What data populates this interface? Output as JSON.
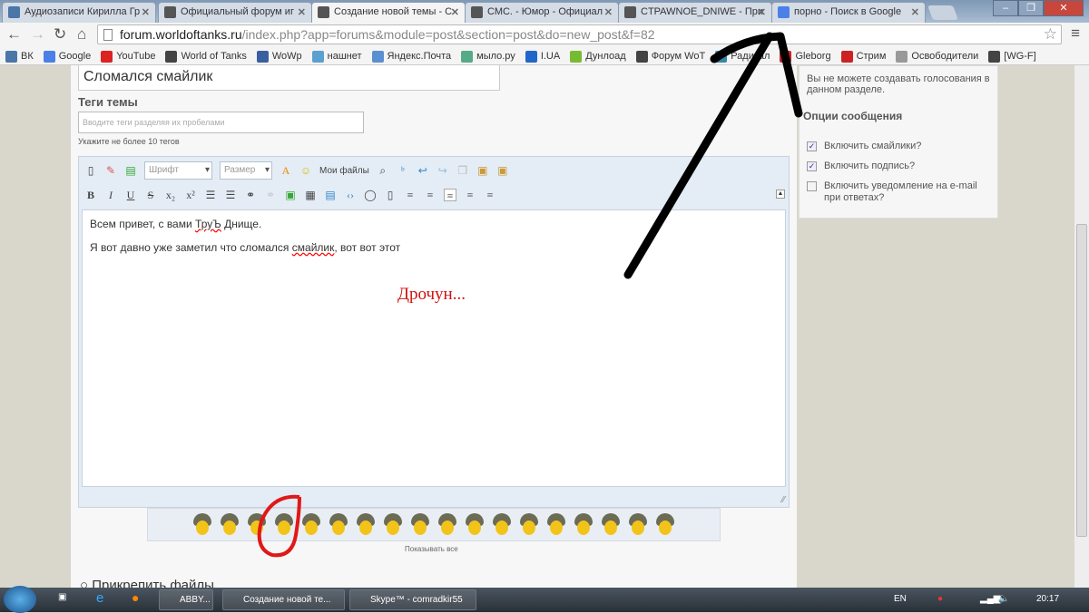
{
  "tabs": [
    {
      "title": "Аудиозаписи Кирилла Гр",
      "color": "#4a76a8"
    },
    {
      "title": "Официальный форум иг",
      "color": "#444"
    },
    {
      "title": "Создание новой темы - С",
      "color": "#444"
    },
    {
      "title": "СМС. - Юмор - Официал",
      "color": "#444"
    },
    {
      "title": "CTPAWNOE_DNIWE - При",
      "color": "#444"
    },
    {
      "title": "порно - Поиск в Google",
      "color": "#4a80e8"
    }
  ],
  "address": {
    "host": "forum.worldoftanks.ru",
    "path": "/index.php?app=forums&module=post&section=post&do=new_post&f=82"
  },
  "bookmarks": [
    "ВК",
    "Google",
    "YouTube",
    "World of Tanks",
    "WoWp",
    "нашнет",
    "Яндекс.Почта",
    "мыло.ру",
    "I.UA",
    "Дунлоад",
    "Форум WoT",
    "Радикал",
    "Gleborg",
    "Стрим",
    "Освободители",
    "[WG-F]"
  ],
  "form": {
    "title_value": "Сломался смайлик",
    "tags_label": "Теги темы",
    "tags_placeholder": "Вводите теги разделяя их пробелами",
    "tags_hint": "Укажите не более 10 тегов",
    "font_select": "Шрифт",
    "size_select": "Размер",
    "my_files": "Мои файлы",
    "body_line1_a": "Всем привет, с вами ",
    "body_line1_b": "ТруЪ",
    "body_line1_c": " Днище.",
    "body_line2_a": "Я вот давно уже заметил что сломался ",
    "body_line2_b": "смайлик",
    "body_line2_c": ", вот вот этот",
    "show_all": "Показывать все",
    "attach": "Прикрепить файлы",
    "smiley_count": 18
  },
  "annotation": "Дрочун...",
  "right_panel": {
    "poll_note": "Вы не можете создавать голосования в данном разделе.",
    "heading": "Опции сообщения",
    "options": [
      {
        "label": "Включить смайлики?",
        "checked": true
      },
      {
        "label": "Включить подпись?",
        "checked": true
      },
      {
        "label": "Включить уведомление на e-mail при ответах?",
        "checked": false
      }
    ]
  },
  "taskbar": {
    "items": [
      "ABBY...",
      "Создание новой те...",
      "Skype™ - comradkir55"
    ],
    "lang": "EN",
    "clock": "20:17"
  }
}
